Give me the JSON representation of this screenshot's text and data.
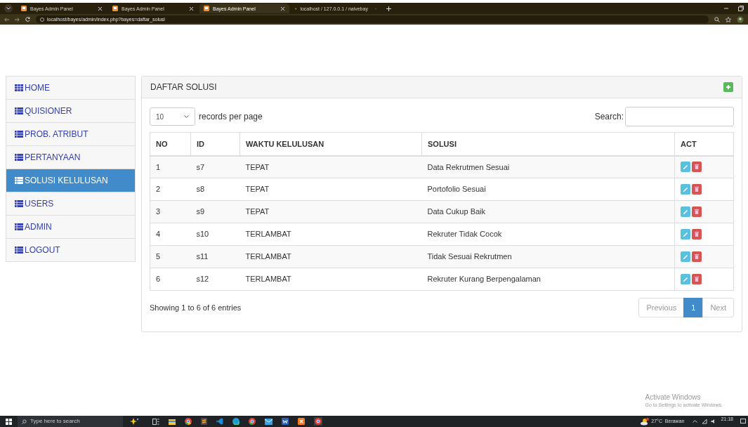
{
  "browser": {
    "tabs": [
      {
        "title": "Bayes Admin Panel",
        "selected": false,
        "kind": "app"
      },
      {
        "title": "Bayes Admin Panel",
        "selected": false,
        "kind": "app"
      },
      {
        "title": "Bayes Admin Panel",
        "selected": true,
        "kind": "app"
      },
      {
        "title": "localhost / 127.0.0.1 / naivebay",
        "selected": false,
        "kind": "db"
      }
    ],
    "url": "localhost/bayes/admin/index.php?bayes=daftar_solusi"
  },
  "sidebar": {
    "items": [
      {
        "label": "HOME",
        "kind": "grid",
        "selected": false
      },
      {
        "label": "QUISIONER",
        "kind": "list",
        "selected": false
      },
      {
        "label": "PROB. ATRIBUT",
        "kind": "list",
        "selected": false
      },
      {
        "label": "PERTANYAAN",
        "kind": "list",
        "selected": false
      },
      {
        "label": "SOLUSI KELULUSAN",
        "kind": "list",
        "selected": true
      },
      {
        "label": "USERS",
        "kind": "list",
        "selected": false
      },
      {
        "label": "ADMIN",
        "kind": "list",
        "selected": false
      },
      {
        "label": "LOGOUT",
        "kind": "list",
        "selected": false
      }
    ]
  },
  "panel": {
    "title": "DAFTAR SOLUSI",
    "length": {
      "value": "10",
      "label": "records per page"
    },
    "search": {
      "label": "Search:"
    },
    "table": {
      "columns": [
        "NO",
        "ID",
        "WAKTU KELULUSAN",
        "SOLUSI",
        "ACT"
      ],
      "rows": [
        [
          "1",
          "s7",
          "TEPAT",
          "Data Rekrutmen Sesuai"
        ],
        [
          "2",
          "s8",
          "TEPAT",
          "Portofolio Sesuai"
        ],
        [
          "3",
          "s9",
          "TEPAT",
          "Data Cukup Baik"
        ],
        [
          "4",
          "s10",
          "TERLAMBAT",
          "Rekruter Tidak Cocok"
        ],
        [
          "5",
          "s11",
          "TERLAMBAT",
          "Tidak Sesuai Rekrutmen"
        ],
        [
          "6",
          "s12",
          "TERLAMBAT",
          "Rekruter Kurang Berpengalaman"
        ]
      ]
    },
    "info": "Showing 1 to 6 of 6 entries",
    "pagination": [
      {
        "label": "Previous",
        "selected": false
      },
      {
        "label": "1",
        "selected": true
      },
      {
        "label": "Next",
        "selected": false
      }
    ]
  },
  "activation": {
    "title": "Activate Windows",
    "subtitle": "Go to Settings to activate Windows."
  },
  "taskbar": {
    "search_placeholder": "Type here to search",
    "weather": "27°C  Berawan",
    "time": "21:18"
  }
}
